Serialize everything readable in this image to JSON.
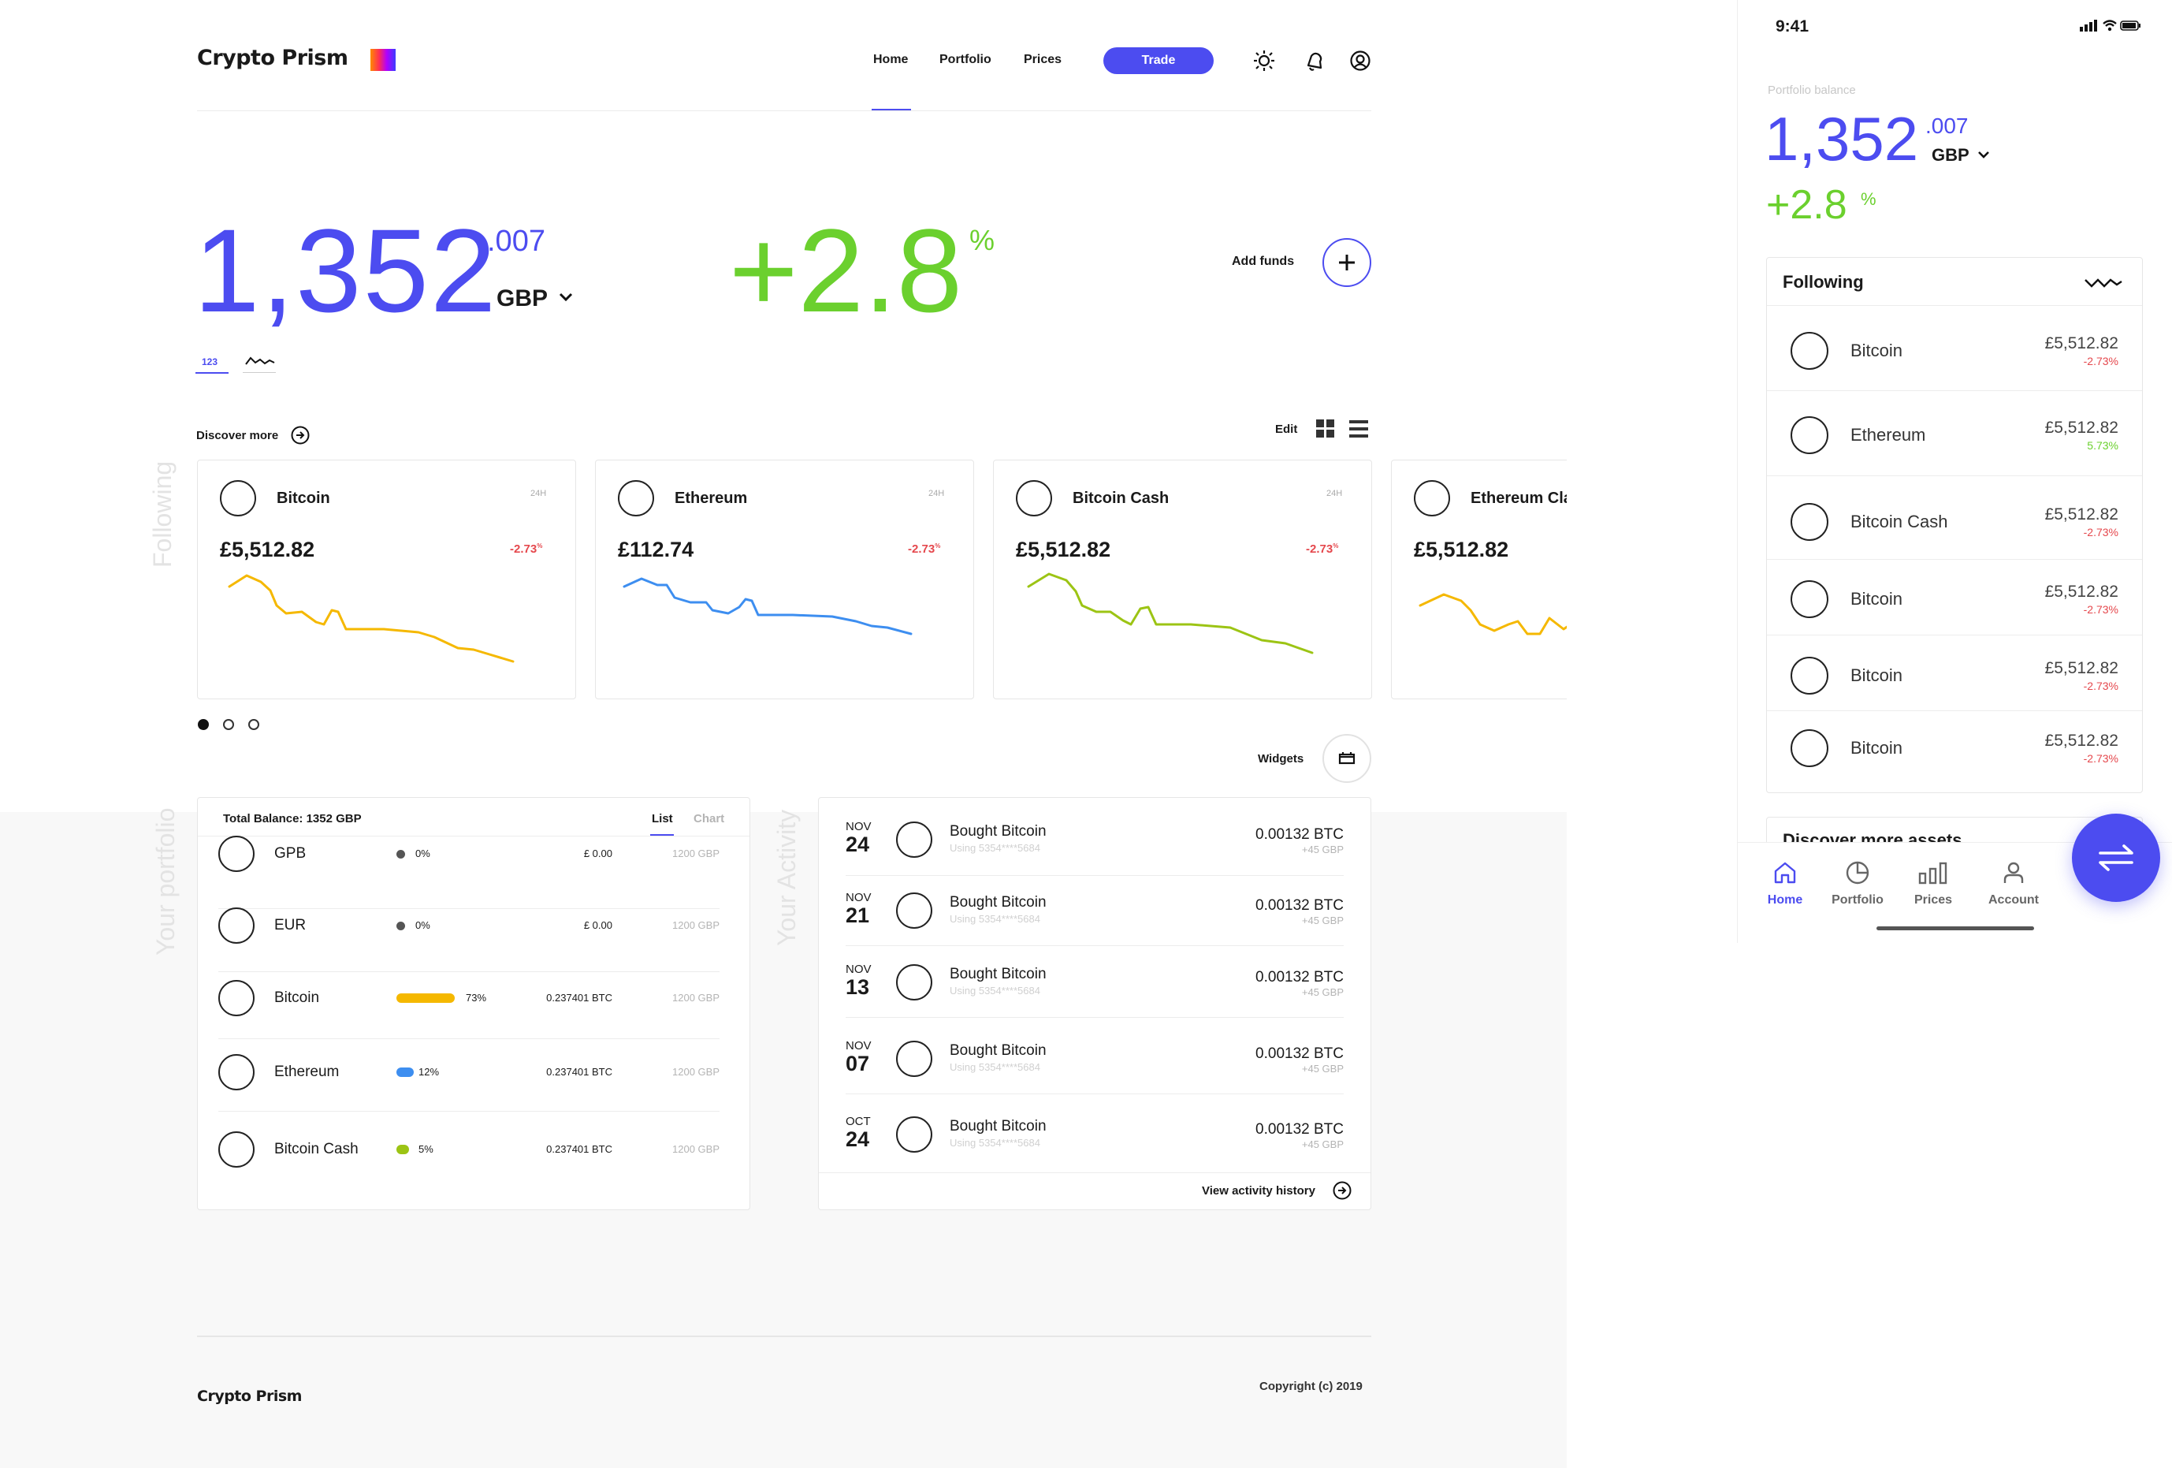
{
  "app": {
    "name": "Crypto Prism"
  },
  "nav": {
    "home": "Home",
    "portfolio": "Portfolio",
    "prices": "Prices",
    "trade": "Trade"
  },
  "hero": {
    "balance_int": "1,352",
    "balance_dec": ".007",
    "currency": "GBP",
    "change": "+2.8",
    "change_unit": "%",
    "add_funds": "Add funds",
    "view_123": "123"
  },
  "discover": {
    "label": "Discover more",
    "edit": "Edit"
  },
  "side_labels": {
    "following": "Following",
    "portfolio": "Your portfolio",
    "activity": "Your Activity"
  },
  "cards": [
    {
      "name": "Bitcoin",
      "period": "24H",
      "price": "£5,512.82",
      "change": "-2.73",
      "unit": "%",
      "color": "#f5b800"
    },
    {
      "name": "Ethereum",
      "period": "24H",
      "price": "£112.74",
      "change": "-2.73",
      "unit": "%",
      "color": "#3d8ef0"
    },
    {
      "name": "Bitcoin Cash",
      "period": "24H",
      "price": "£5,512.82",
      "change": "-2.73",
      "unit": "%",
      "color": "#9cc414"
    },
    {
      "name": "Ethereum Cla",
      "period": "",
      "price": "£5,512.82",
      "change": "",
      "unit": "",
      "color": "#f5b800"
    }
  ],
  "widgets": {
    "label": "Widgets"
  },
  "portfolio": {
    "total": "Total Balance: 1352 GBP",
    "tab_list": "List",
    "tab_chart": "Chart",
    "rows": [
      {
        "name": "GPB",
        "pct": "0%",
        "amount": "£ 0.00",
        "gbp": "1200 GBP",
        "color": "#555",
        "share": 0
      },
      {
        "name": "EUR",
        "pct": "0%",
        "amount": "£ 0.00",
        "gbp": "1200 GBP",
        "color": "#555",
        "share": 0
      },
      {
        "name": "Bitcoin",
        "pct": "73%",
        "amount": "0.237401 BTC",
        "gbp": "1200 GBP",
        "color": "#f5b800",
        "share": 0.73
      },
      {
        "name": "Ethereum",
        "pct": "12%",
        "amount": "0.237401 BTC",
        "gbp": "1200 GBP",
        "color": "#3d8ef0",
        "share": 0.12
      },
      {
        "name": "Bitcoin Cash",
        "pct": "5%",
        "amount": "0.237401 BTC",
        "gbp": "1200 GBP",
        "color": "#9cc414",
        "share": 0.05
      }
    ]
  },
  "activity": {
    "rows": [
      {
        "month": "NOV",
        "day": "24",
        "title": "Bought Bitcoin",
        "sub": "Using 5354****5684",
        "amount": "0.00132 BTC",
        "gbp": "+45 GBP"
      },
      {
        "month": "NOV",
        "day": "21",
        "title": "Bought Bitcoin",
        "sub": "Using 5354****5684",
        "amount": "0.00132 BTC",
        "gbp": "+45 GBP"
      },
      {
        "month": "NOV",
        "day": "13",
        "title": "Bought Bitcoin",
        "sub": "Using 5354****5684",
        "amount": "0.00132 BTC",
        "gbp": "+45 GBP"
      },
      {
        "month": "NOV",
        "day": "07",
        "title": "Bought Bitcoin",
        "sub": "Using 5354****5684",
        "amount": "0.00132 BTC",
        "gbp": "+45 GBP"
      },
      {
        "month": "OCT",
        "day": "24",
        "title": "Bought Bitcoin",
        "sub": "Using 5354****5684",
        "amount": "0.00132 BTC",
        "gbp": "+45 GBP"
      }
    ],
    "view_history": "View activity history"
  },
  "footer": {
    "logo": "Crypto Prism",
    "copyright": "Copyright (c) 2019"
  },
  "mobile": {
    "time": "9:41",
    "balance_label": "Portfolio balance",
    "balance_int": "1,352",
    "balance_dec": ".007",
    "currency": "GBP",
    "change": "+2.8",
    "unit": "%",
    "following": "Following",
    "rows": [
      {
        "name": "Bitcoin",
        "price": "£5,512.82",
        "change": "-2.73%",
        "color": "#e5484d"
      },
      {
        "name": "Ethereum",
        "price": "£5,512.82",
        "change": "5.73%",
        "color": "#6bd02e"
      },
      {
        "name": "Bitcoin Cash",
        "price": "£5,512.82",
        "change": "-2.73%",
        "color": "#e5484d"
      },
      {
        "name": "Bitcoin",
        "price": "£5,512.82",
        "change": "-2.73%",
        "color": "#e5484d"
      },
      {
        "name": "Bitcoin",
        "price": "£5,512.82",
        "change": "-2.73%",
        "color": "#e5484d"
      },
      {
        "name": "Bitcoin",
        "price": "£5,512.82",
        "change": "-2.73%",
        "color": "#e5484d"
      }
    ],
    "discover": "Discover more assets",
    "tabs": {
      "home": "Home",
      "portfolio": "Portfolio",
      "prices": "Prices",
      "account": "Account"
    }
  },
  "colors": {
    "accent": "#4c4cf0",
    "positive": "#6bd02e",
    "negative": "#e5484d"
  }
}
